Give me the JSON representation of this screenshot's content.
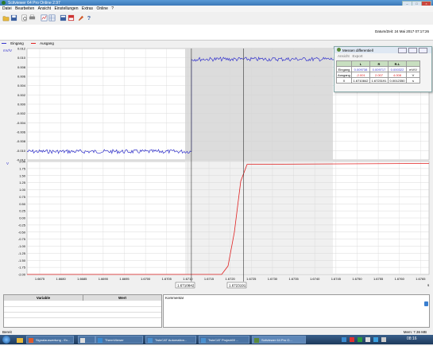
{
  "window": {
    "title": "Scitviewer 64 Pro Online 2.97"
  },
  "menu": [
    "Datei",
    "Bearbeiten",
    "Ansicht",
    "Einstellungen",
    "Extras",
    "Online",
    "?"
  ],
  "header": {
    "datetime": "Datum/Zeit: 24 Mai 2017 07:17:26"
  },
  "legend": {
    "series1": "Eingang",
    "series2": "Ausgang",
    "color1": "#3333cc",
    "color2": "#e02020"
  },
  "chart_data": {
    "type": "line",
    "unit_top": "mV/V",
    "top": {
      "yticks": [
        "0.012",
        "0.010",
        "0.008",
        "0.006",
        "0.004",
        "0.002",
        "0.000",
        "-0.002",
        "-0.004",
        "-0.006",
        "-0.008",
        "-0.010",
        "-0.012"
      ],
      "ylim": [
        -0.012,
        0.012
      ]
    },
    "unit_bottom": "V",
    "bottom": {
      "yticks": [
        "2.00",
        "1.75",
        "1.50",
        "1.25",
        "1.00",
        "0.75",
        "0.50",
        "0.25",
        "0.00",
        "-0.25",
        "-0.50",
        "-0.75",
        "-1.00",
        "-1.25",
        "-1.50",
        "-1.75",
        "-2.00"
      ],
      "ylim": [
        -2.0,
        2.0
      ]
    },
    "xticks": [
      "1.6675",
      "1.6680",
      "1.6685",
      "1.6690",
      "1.6695",
      "1.6700",
      "1.6705",
      "1.6710",
      "1.6715",
      "1.6720",
      "1.6725",
      "1.6730",
      "1.6735",
      "1.6740",
      "1.6745",
      "1.6750",
      "1.6755",
      "1.6760",
      "1.6765"
    ],
    "xlim": [
      1.6672,
      1.6767
    ],
    "xunit": "s",
    "cursor1": "1.6710842",
    "cursor2": "1.6723191",
    "series": [
      {
        "name": "Eingang",
        "x": [
          1.6672,
          1.6710842,
          1.6710842,
          1.6767
        ],
        "y": [
          -0.0102,
          -0.0102,
          0.0097,
          0.0097
        ]
      },
      {
        "name": "Ausgang",
        "x": [
          1.6672,
          1.6718,
          1.67195,
          1.6721,
          1.67225,
          1.6724,
          1.6767
        ],
        "y": [
          -2.0,
          -2.0,
          -1.7,
          -0.5,
          1.3,
          1.9,
          1.93
        ]
      }
    ]
  },
  "measure": {
    "title": "Messen differentiell",
    "menu": [
      "Ansicht",
      "Export"
    ],
    "headers": [
      "",
      "L",
      "R",
      "R-L",
      ""
    ],
    "rows": [
      [
        "Eingang",
        "0.009738",
        "0.009717",
        "0.000322",
        "mV/V"
      ],
      [
        "Ausgang",
        "-2.001",
        "2.007",
        "4.008",
        "V"
      ],
      [
        "X",
        "1.6710842",
        "1.6723191",
        "0.0012350",
        "s"
      ]
    ]
  },
  "bottom": {
    "col_variable": "Variable",
    "col_wert": "Wert",
    "comment": "Kommentar"
  },
  "status": {
    "left": "Bereit",
    "right": "Mem: 7.36 MB"
  },
  "taskbar": {
    "items": [
      "Signalauswertung - Ex...",
      "ThermViewer",
      "TwinCAT Automation...",
      "TwinCAT Project69 ...",
      "Scitviewer 64 Pro O..."
    ],
    "clock": "08:16"
  }
}
